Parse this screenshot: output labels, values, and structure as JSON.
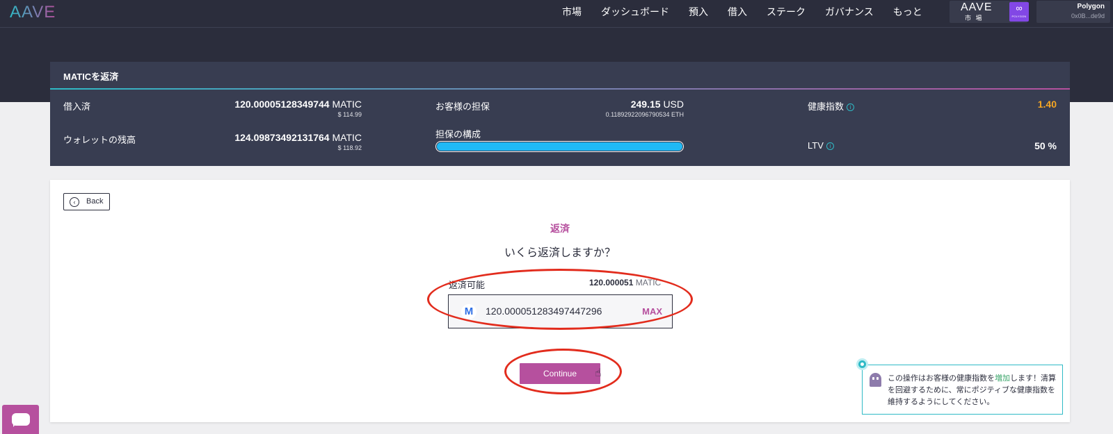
{
  "nav": {
    "logo": "AAVE",
    "menu": [
      "市場",
      "ダッシュボード",
      "預入",
      "借入",
      "ステーク",
      "ガバナンス",
      "もっと"
    ],
    "market_logo": "AAVE",
    "market_label": "市 場",
    "polygon_badge": "POLYGON",
    "network": "Polygon",
    "address": "0x0B...de9d"
  },
  "summary": {
    "title": "MATICを返済",
    "borrowed_label": "借入済",
    "borrowed_amount": "120.00005128349744",
    "borrowed_unit": "MATIC",
    "borrowed_usd": "$ 114.99",
    "wallet_label": "ウォレットの残高",
    "wallet_amount": "124.09873492131764",
    "wallet_unit": "MATIC",
    "wallet_usd": "$ 118.92",
    "collateral_label": "お客様の担保",
    "collateral_amount": "249.15",
    "collateral_unit": "USD",
    "collateral_eth": "0.11892922096790534 ETH",
    "composition_label": "担保の構成",
    "composition_fill": 1.0,
    "health_label": "健康指数",
    "health_value": "1.40",
    "ltv_label": "LTV",
    "ltv_value": "50 %",
    "info_icon": "i"
  },
  "colors": {
    "accent_purple": "#b6509e",
    "accent_teal": "#2ebac6",
    "health_orange": "#f5a623",
    "bar_blue": "#20b9f5"
  },
  "card": {
    "back_label": "Back",
    "back_icon_glyph": "‹",
    "title": "返済",
    "question": "いくら返済しますか？",
    "available_label": "返済可能",
    "available_value": "120.000051",
    "available_unit": "MATIC",
    "amount_value": "120.000051283497447296",
    "max_label": "MAX",
    "matic_glyph": "M",
    "continue_label": "Continue"
  },
  "notice": {
    "text_1": "この操作はお客様の健康指数を",
    "highlight": "増加",
    "text_2": "します！清算を回避するために、常にポジティブな健康指数を維持するようにしてください。"
  }
}
